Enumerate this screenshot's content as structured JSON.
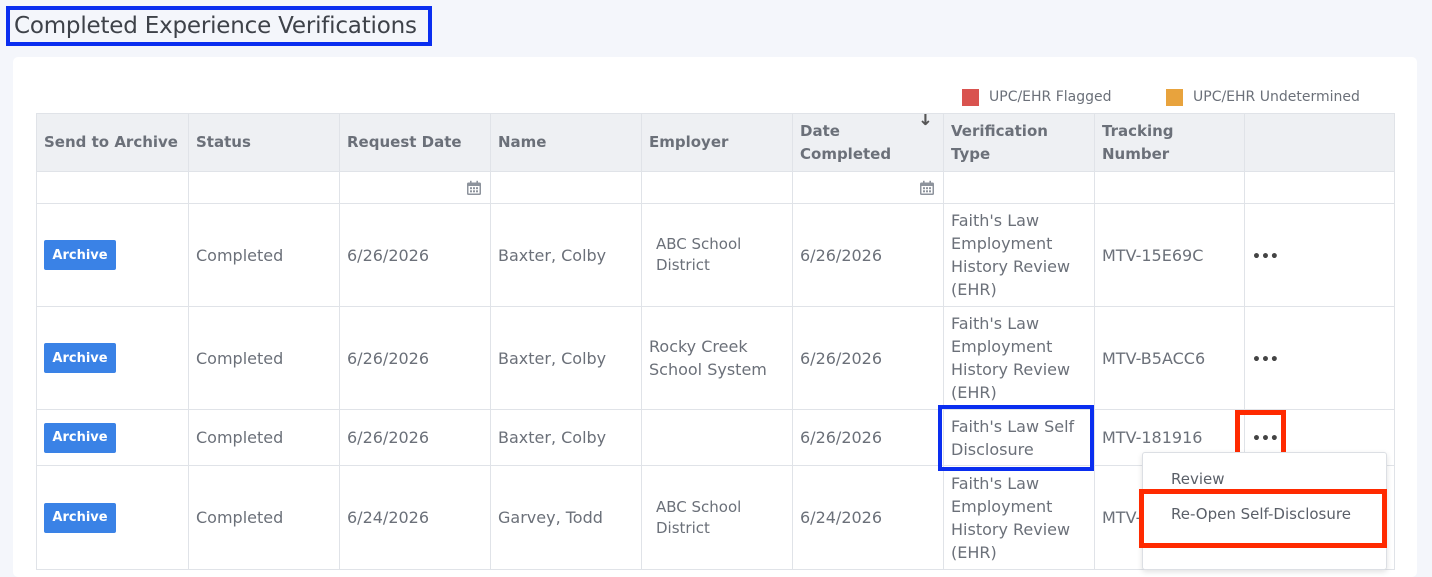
{
  "page": {
    "title": "Completed Experience Verifications"
  },
  "legend": [
    {
      "label": "UPC/EHR Flagged",
      "color": "#d9534f"
    },
    {
      "label": "UPC/EHR Undetermined",
      "color": "#e8a33d"
    }
  ],
  "table": {
    "headers": {
      "archive": "Send to Archive",
      "status": "Status",
      "request_date": "Request Date",
      "name": "Name",
      "employer": "Employer",
      "date_completed": "Date Completed",
      "verification_type": "Verification Type",
      "tracking": "Tracking Number"
    },
    "sort_icon": "arrow-down-icon",
    "filter_icon": "calendar-icon",
    "archive_label": "Archive",
    "actions_icon": "ellipsis-icon",
    "rows": [
      {
        "status": "Completed",
        "request_date": "6/26/2026",
        "name": "Baxter, Colby",
        "employer": "ABC School District",
        "date_completed": "6/26/2026",
        "verification_type": "Faith's Law Employment History Review (EHR)",
        "tracking": "MTV-15E69C"
      },
      {
        "status": "Completed",
        "request_date": "6/26/2026",
        "name": "Baxter, Colby",
        "employer": "Rocky Creek School System",
        "date_completed": "6/26/2026",
        "verification_type": "Faith's Law Employment History Review (EHR)",
        "tracking": "MTV-B5ACC6"
      },
      {
        "status": "Completed",
        "request_date": "6/26/2026",
        "name": "Baxter, Colby",
        "employer": "",
        "date_completed": "6/26/2026",
        "verification_type": "Faith's Law Self Disclosure",
        "tracking": "MTV-181916"
      },
      {
        "status": "Completed",
        "request_date": "6/24/2026",
        "name": "Garvey, Todd",
        "employer": "ABC School District",
        "date_completed": "6/24/2026",
        "verification_type": "Faith's Law Employment History Review (EHR)",
        "tracking": "MTV-"
      }
    ]
  },
  "context_menu": {
    "items": [
      "Review",
      "Re-Open Self-Disclosure"
    ]
  }
}
